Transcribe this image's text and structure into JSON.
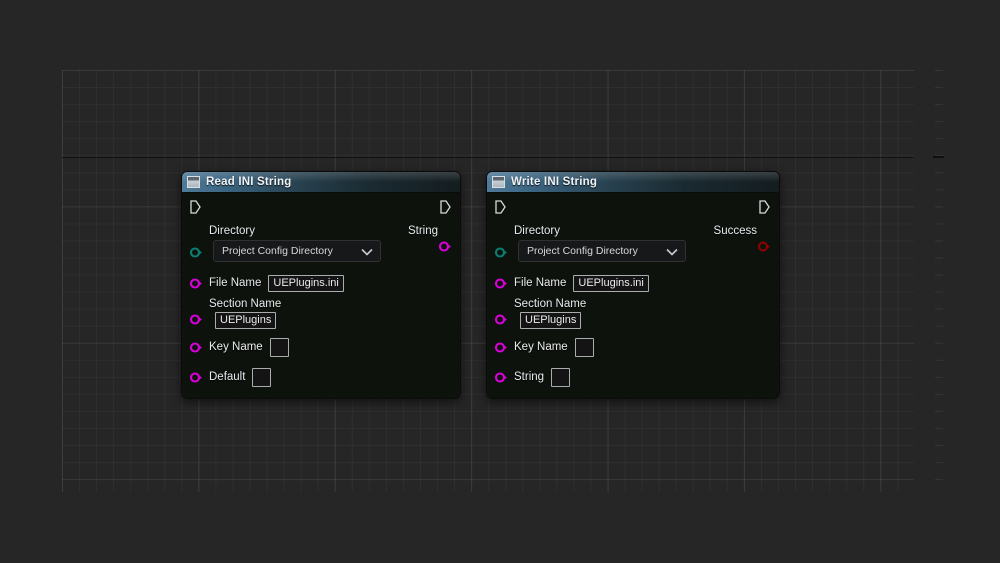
{
  "canvas": {
    "background_color": "#262626",
    "grid_line_color": "#303030",
    "grid_major_color": "#383838",
    "axis_color": "#111111"
  },
  "palette": {
    "exec_pin": "#d8dada",
    "string_pin": "#d800d8",
    "bool_pin": "#8c0000",
    "directory_enum_pin": "#0c7d73",
    "header_accent": "#4f7b99",
    "node_body": "#0d120d"
  },
  "nodes": [
    {
      "id": "read-ini-string",
      "title": "Read INI String",
      "icon": "window-icon",
      "exec_in": {
        "name": "exec-in-pin",
        "type": "exec"
      },
      "exec_out": {
        "name": "exec-out-pin",
        "type": "exec"
      },
      "directory": {
        "label": "Directory",
        "pin_type": "enum",
        "combo_value": "Project Config Directory",
        "chevron": "chevron-down-icon"
      },
      "output": {
        "label": "String",
        "pin_type": "string"
      },
      "inputs": [
        {
          "label": "File Name",
          "value": "UEPlugins.ini",
          "layout": "inline",
          "pin_type": "string"
        },
        {
          "label": "Section Name",
          "value": "UEPlugins",
          "layout": "stacked",
          "pin_type": "string"
        },
        {
          "label": "Key Name",
          "value": "",
          "layout": "inline",
          "pin_type": "string"
        },
        {
          "label": "Default",
          "value": "",
          "layout": "inline",
          "pin_type": "string"
        }
      ]
    },
    {
      "id": "write-ini-string",
      "title": "Write INI String",
      "icon": "window-icon",
      "exec_in": {
        "name": "exec-in-pin",
        "type": "exec"
      },
      "exec_out": {
        "name": "exec-out-pin",
        "type": "exec"
      },
      "directory": {
        "label": "Directory",
        "pin_type": "enum",
        "combo_value": "Project Config Directory",
        "chevron": "chevron-down-icon"
      },
      "output": {
        "label": "Success",
        "pin_type": "bool"
      },
      "inputs": [
        {
          "label": "File Name",
          "value": "UEPlugins.ini",
          "layout": "inline",
          "pin_type": "string"
        },
        {
          "label": "Section Name",
          "value": "UEPlugins",
          "layout": "stacked",
          "pin_type": "string"
        },
        {
          "label": "Key Name",
          "value": "",
          "layout": "inline",
          "pin_type": "string"
        },
        {
          "label": "String",
          "value": "",
          "layout": "inline",
          "pin_type": "string"
        }
      ]
    }
  ]
}
